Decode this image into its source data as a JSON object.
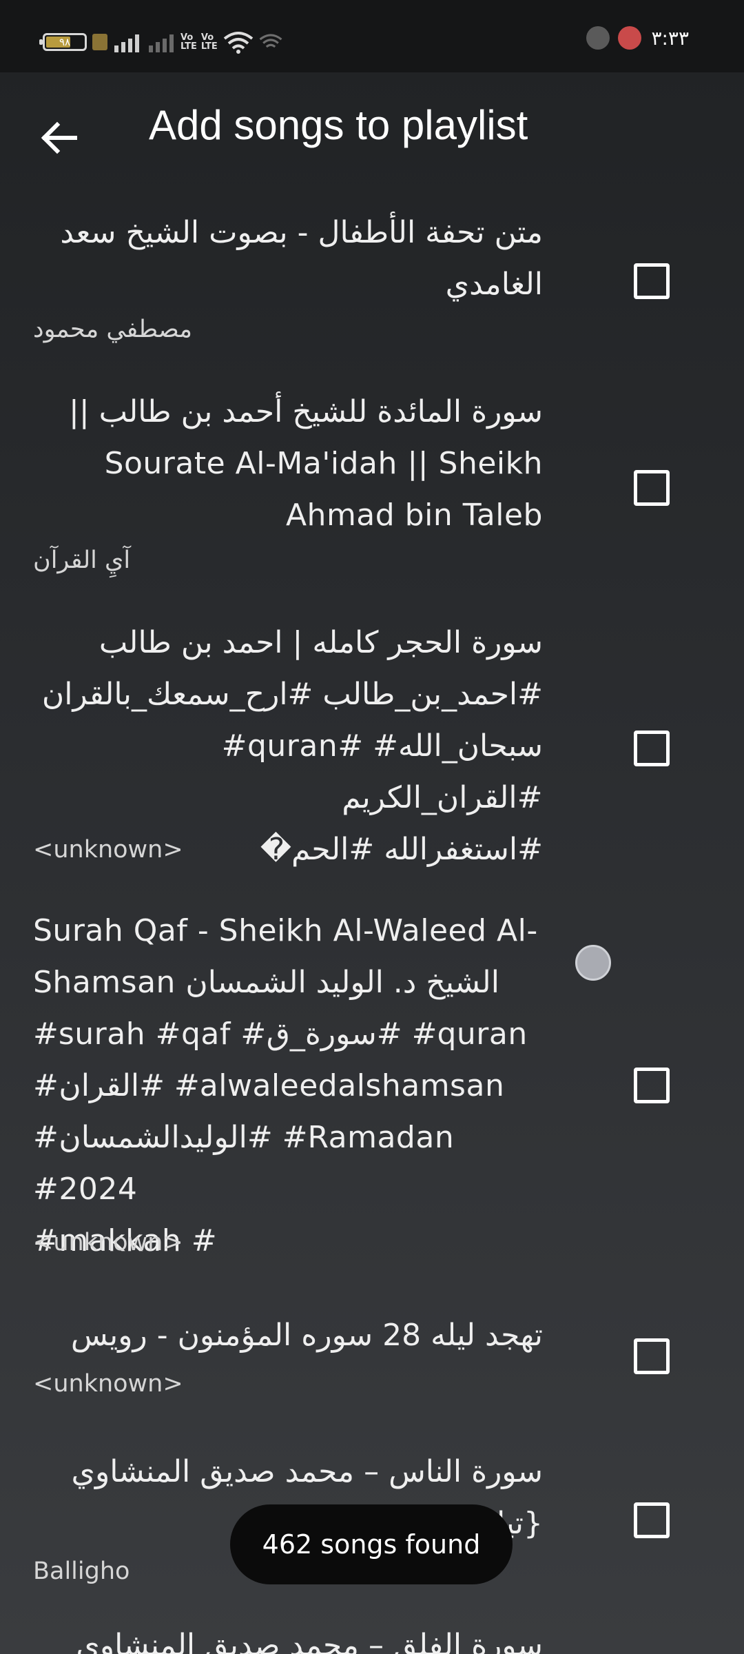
{
  "status_bar": {
    "battery": "٩٨",
    "volte_1": "Vo",
    "volte_2": "LTE",
    "time": "٣:٣٣"
  },
  "header": {
    "title": "Add songs to playlist"
  },
  "songs": [
    {
      "title": "متن تحفة الأطفال - بصوت الشيخ سعد\nالغامدي",
      "artist": "مصطفي محمود"
    },
    {
      "title": "سورة المائدة للشيخ أحمد بن طالب ||\nSourate Al-Ma'idah || Sheikh\nAhmad bin Taleb",
      "artist": "آيِ القرآن"
    },
    {
      "title": "سورة الحجر كامله | احمد بن طالب\n#احمد_بن_طالب #ارح_سمعك_بالقران\nسبحان_الله# #quran# #القران_الكريم\n#استغفرالله #الحم�",
      "artist": "<unknown>"
    },
    {
      "title": "Surah Qaf - Sheikh Al-Waleed Al-\nShamsan الشيخ د. الوليد الشمسان\n#surah #qaf #سورة_ق# #quran\n#القران# #alwaleedalshamsan\n#الوليدالشمسان# #Ramadan #2024\n#makkah #",
      "artist": "<unknown>"
    },
    {
      "title": "تهجد ليله 28 سوره المؤمنون - رويس",
      "artist": "<unknown>"
    },
    {
      "title": "سورة الناس – محمد صديق المنشاوي\n{تيل جودة عالية",
      "artist": "Balligho"
    },
    {
      "title": "سورة الفلق – محمد صديق المنشاوي",
      "artist": ""
    }
  ],
  "toast": {
    "text": "462 songs found"
  },
  "icons": {
    "back": "arrow-left-icon",
    "checkbox": "checkbox-unchecked-icon"
  },
  "colors": {
    "background_top": "#202224",
    "background_bottom": "#3a3c3f",
    "status_bar": "#151617",
    "toast_bg": "#0b0b0b",
    "text": "#efefef"
  }
}
